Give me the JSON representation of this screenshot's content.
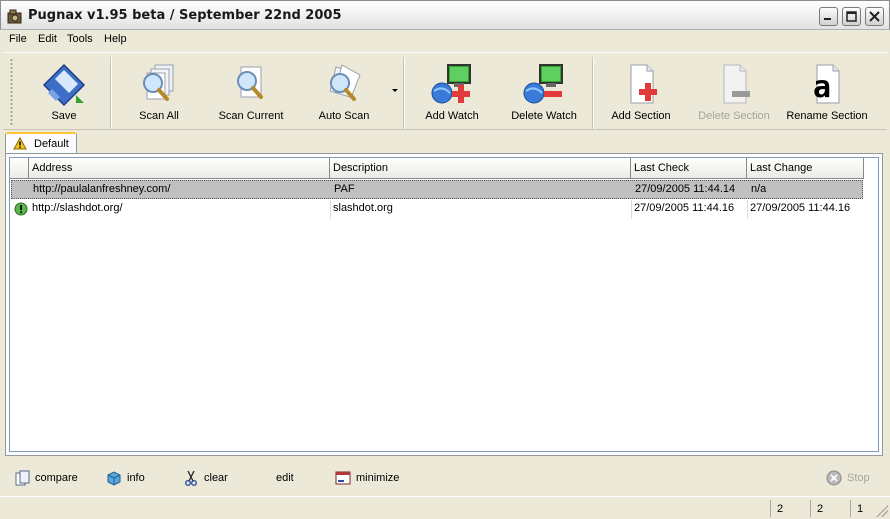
{
  "window": {
    "title": "Pugnax v1.95 beta / September 22nd 2005"
  },
  "menu": [
    "File",
    "Edit",
    "Tools",
    "Help"
  ],
  "toolbar": {
    "save": "Save",
    "scan_all": "Scan All",
    "scan_current": "Scan Current",
    "auto_scan": "Auto Scan",
    "add_watch": "Add Watch",
    "delete_watch": "Delete Watch",
    "add_section": "Add Section",
    "delete_section": "Delete Section",
    "rename_section": "Rename Section"
  },
  "tabs": [
    {
      "label": "Default",
      "icon": "warning-icon",
      "selected": true
    }
  ],
  "list": {
    "columns": [
      "Address",
      "Description",
      "Last Check",
      "Last Change"
    ],
    "rows": [
      {
        "address": "http://paulalanfreshney.com/",
        "description": "PAF",
        "last_check": "27/09/2005 11:44.14",
        "last_change": "n/a",
        "selected": true,
        "status_icon": ""
      },
      {
        "address": "http://slashdot.org/",
        "description": "slashdot.org",
        "last_check": "27/09/2005 11:44.16",
        "last_change": "27/09/2005 11:44.16",
        "selected": false,
        "status_icon": "changed-icon"
      }
    ]
  },
  "bottom_bar": {
    "compare": "compare",
    "info": "info",
    "clear": "clear",
    "edit": "edit",
    "minimize": "minimize",
    "stop": "Stop"
  },
  "status": [
    "2",
    "2",
    "1"
  ],
  "colors": {
    "selected_row": "#c0c0c0",
    "tab_accent": "#ffc83c"
  }
}
